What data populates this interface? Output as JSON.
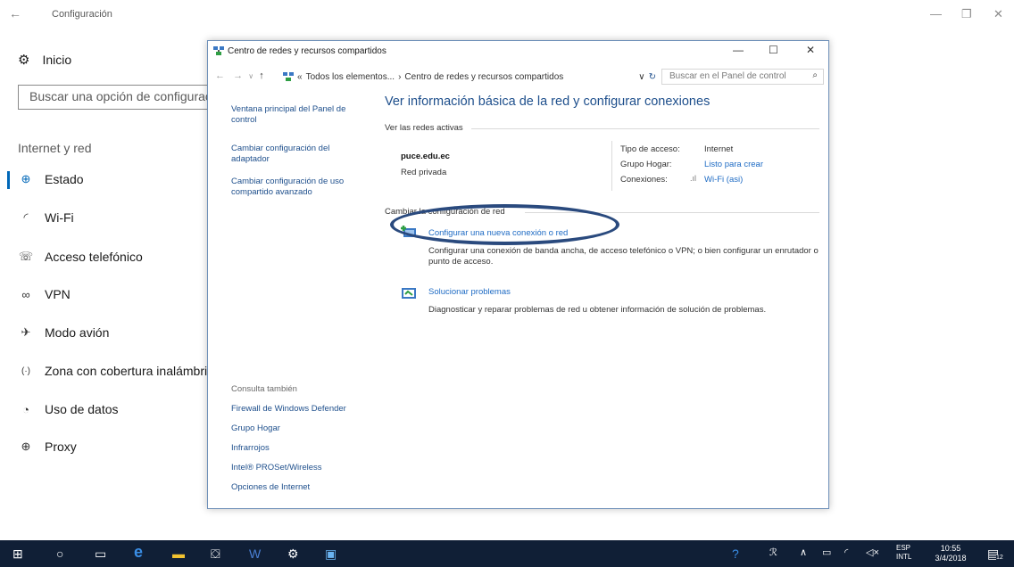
{
  "settings": {
    "title": "Configuración",
    "home": "Inicio",
    "search_placeholder": "Buscar una opción de configuración",
    "section": "Internet y red",
    "nav": [
      "Estado",
      "Wi-Fi",
      "Acceso telefónico",
      "VPN",
      "Modo avión",
      "Zona con cobertura inalámbrica",
      "Uso de datos",
      "Proxy"
    ],
    "nav_icons": [
      "globe-icon",
      "wifi-icon",
      "dialup-icon",
      "vpn-icon",
      "airplane-icon",
      "hotspot-icon",
      "data-usage-icon",
      "globe-icon"
    ]
  },
  "cp": {
    "title": "Centro de redes y recursos compartidos",
    "breadcrumb": {
      "prefix": "«",
      "item1": "Todos los elementos...",
      "sep": "›",
      "item2": "Centro de redes y recursos compartidos"
    },
    "search_placeholder": "Buscar en el Panel de control",
    "left_links": [
      "Ventana principal del Panel de control",
      "Cambiar configuración del adaptador",
      "Cambiar configuración de uso compartido avanzado"
    ],
    "see_also_title": "Consulta también",
    "see_also": [
      "Firewall de Windows Defender",
      "Grupo Hogar",
      "Infrarrojos",
      "Intel® PROSet/Wireless",
      "Opciones de Internet"
    ],
    "heading": "Ver información básica de la red y configurar conexiones",
    "active_networks_label": "Ver las redes activas",
    "network": {
      "name": "puce.edu.ec",
      "type": "Red privada",
      "access_label": "Tipo de acceso:",
      "access_value": "Internet",
      "homegroup_label": "Grupo Hogar:",
      "homegroup_value": "Listo para crear",
      "connections_label": "Conexiones:",
      "connections_value": "Wi-Fi (asi)"
    },
    "change_settings_label": "Cambiar la configuración de red",
    "tasks": [
      {
        "title": "Configurar una nueva conexión o red",
        "desc": "Configurar una conexión de banda ancha, de acceso telefónico o VPN; o bien configurar un enrutador o punto de acceso."
      },
      {
        "title": "Solucionar problemas",
        "desc": "Diagnosticar y reparar problemas de red u obtener información de solución de problemas."
      }
    ]
  },
  "taskbar": {
    "lang1": "ESP",
    "lang2": "INTL",
    "time": "10:55",
    "date": "3/4/2018",
    "notif_count": "12"
  },
  "colors": {
    "accent": "#0067b8",
    "link": "#1e4f8c",
    "taskbar": "#101f36",
    "highlight_ellipse": "#2a4a7e"
  }
}
